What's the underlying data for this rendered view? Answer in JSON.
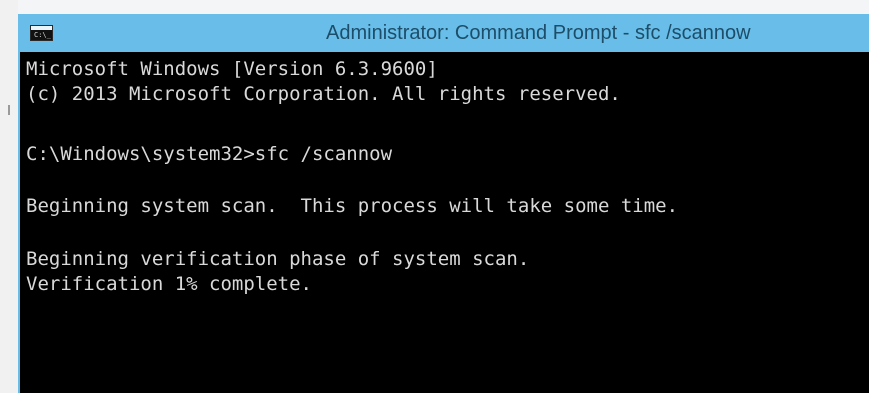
{
  "window": {
    "title": "Administrator: Command Prompt - sfc  /scannow",
    "icon": "command-prompt-icon",
    "icon_text": "C:\\_"
  },
  "console": {
    "lines": [
      "Microsoft Windows [Version 6.3.9600]",
      "(c) 2013 Microsoft Corporation. All rights reserved.",
      "C:\\Windows\\system32>sfc /scannow",
      "Beginning system scan.  This process will take some time.",
      "Beginning verification phase of system scan.",
      "Verification 1% complete."
    ]
  },
  "colors": {
    "titlebar": "#68bee8",
    "title_text": "#1d4d69",
    "console_background": "#000000",
    "console_text": "#d9d9d9"
  }
}
